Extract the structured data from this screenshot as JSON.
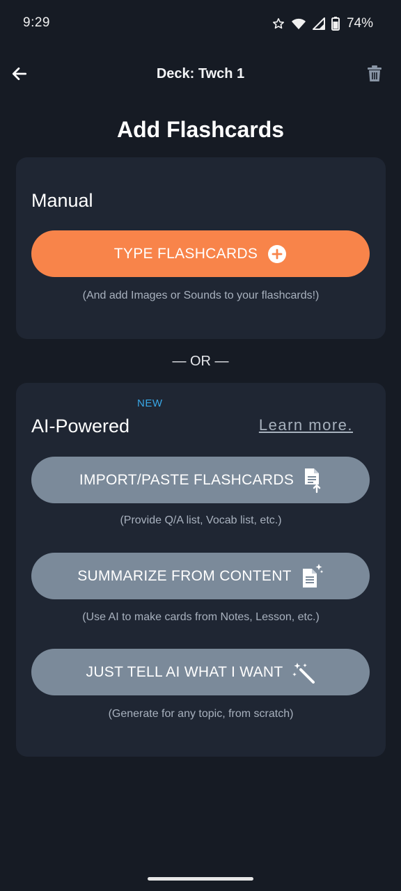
{
  "status_bar": {
    "time": "9:29",
    "battery_percent": "74%",
    "icons": [
      "star-icon",
      "wifi-icon",
      "cell-signal-icon",
      "battery-icon"
    ]
  },
  "header": {
    "deck_title": "Deck: Twch 1",
    "back_icon": "arrow-left-icon",
    "delete_icon": "trash-icon"
  },
  "page_title": "Add Flashcards",
  "manual": {
    "label": "Manual",
    "type_button": {
      "label": "TYPE FLASHCARDS",
      "icon": "plus-circle-icon"
    },
    "hint": "(And add Images or Sounds to your flashcards!)"
  },
  "divider_text": "— OR —",
  "ai": {
    "badge": "NEW",
    "label": "AI-Powered",
    "learn_more": "Learn more.",
    "buttons": [
      {
        "label": "IMPORT/PASTE FLASHCARDS",
        "icon": "document-upload-icon",
        "hint": "(Provide Q/A list, Vocab list, etc.)"
      },
      {
        "label": "SUMMARIZE FROM CONTENT",
        "icon": "document-sparkle-icon",
        "hint": "(Use AI to make cards from Notes, Lesson, etc.)"
      },
      {
        "label": "JUST TELL AI WHAT I WANT",
        "icon": "magic-wand-icon",
        "hint": "(Generate for any topic, from scratch)"
      }
    ]
  },
  "colors": {
    "background": "#161b24",
    "card": "#1f2633",
    "accent_orange": "#f8844a",
    "button_slate": "#7b8a9a",
    "new_badge": "#39a7e6"
  }
}
